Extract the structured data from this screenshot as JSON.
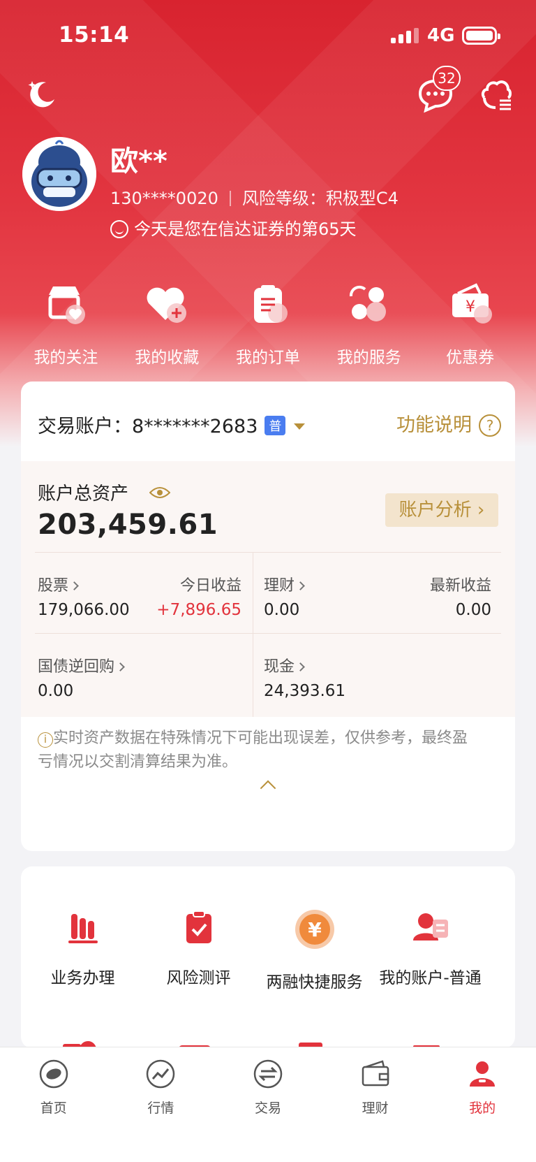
{
  "status_bar": {
    "time": "15:14",
    "network": "4G"
  },
  "header": {
    "message_badge": "32"
  },
  "user": {
    "name": "欧**",
    "phone": "130****0020",
    "risk_label": "风险等级：积极型C4",
    "days_text": "今天是您在信达证券的第65天"
  },
  "quick_actions": [
    {
      "label": "我的关注",
      "icon": "watchlist-icon"
    },
    {
      "label": "我的收藏",
      "icon": "favorites-icon"
    },
    {
      "label": "我的订单",
      "icon": "orders-icon"
    },
    {
      "label": "我的服务",
      "icon": "services-icon"
    },
    {
      "label": "优惠券",
      "icon": "coupon-icon"
    }
  ],
  "account": {
    "label": "交易账户：",
    "number": "8*******2683",
    "type_badge": "普",
    "func_label": "功能说明",
    "func_icon": "?"
  },
  "assets": {
    "title": "账户总资产",
    "total": "203,459.61",
    "analysis_label": "账户分析 ›",
    "stock_label": "股票",
    "stock_value": "179,066.00",
    "today_label": "今日收益",
    "today_value": "+7,896.65",
    "wealth_label": "理财",
    "wealth_value": "0.00",
    "latest_label": "最新收益",
    "latest_value": "0.00",
    "repo_label": "国债逆回购",
    "repo_value": "0.00",
    "cash_label": "现金",
    "cash_value": "24,393.61"
  },
  "note": {
    "icon": "i",
    "text": "实时资产数据在特殊情况下可能出现误差，仅供参考，最终盈亏情况以交割清算结果为准。"
  },
  "services": [
    {
      "label": "业务办理",
      "icon": "business-icon"
    },
    {
      "label": "风险测评",
      "icon": "risk-assessment-icon"
    },
    {
      "label": "两融快捷服务",
      "icon": "margin-service-icon"
    },
    {
      "label": "我的账户-普通",
      "icon": "my-account-icon"
    }
  ],
  "tabs": [
    {
      "label": "首页",
      "icon": "home-icon"
    },
    {
      "label": "行情",
      "icon": "market-icon"
    },
    {
      "label": "交易",
      "icon": "trade-icon"
    },
    {
      "label": "理财",
      "icon": "wallet-icon"
    },
    {
      "label": "我的",
      "icon": "profile-icon"
    }
  ],
  "colors": {
    "brand_red": "#e2333c",
    "gold": "#b8903a",
    "badge_blue": "#4a7df0"
  }
}
